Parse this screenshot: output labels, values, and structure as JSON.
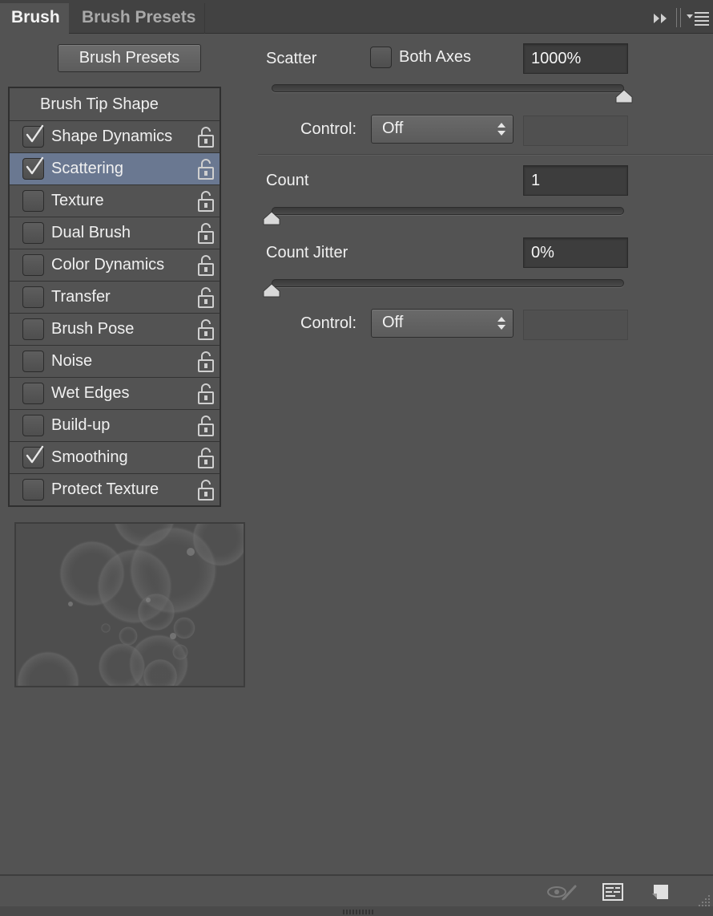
{
  "tabs": [
    {
      "label": "Brush",
      "active": true
    },
    {
      "label": "Brush Presets",
      "active": false
    }
  ],
  "left": {
    "presets_button": "Brush Presets",
    "list_header": "Brush Tip Shape",
    "options": [
      {
        "label": "Shape Dynamics",
        "checked": true,
        "selected": false
      },
      {
        "label": "Scattering",
        "checked": true,
        "selected": true
      },
      {
        "label": "Texture",
        "checked": false,
        "selected": false
      },
      {
        "label": "Dual Brush",
        "checked": false,
        "selected": false
      },
      {
        "label": "Color Dynamics",
        "checked": false,
        "selected": false
      },
      {
        "label": "Transfer",
        "checked": false,
        "selected": false
      },
      {
        "label": "Brush Pose",
        "checked": false,
        "selected": false
      },
      {
        "label": "Noise",
        "checked": false,
        "selected": false
      },
      {
        "label": "Wet Edges",
        "checked": false,
        "selected": false
      },
      {
        "label": "Build-up",
        "checked": false,
        "selected": false
      },
      {
        "label": "Smoothing",
        "checked": true,
        "selected": false
      },
      {
        "label": "Protect Texture",
        "checked": false,
        "selected": false
      }
    ]
  },
  "scatter": {
    "label": "Scatter",
    "both_axes_label": "Both Axes",
    "both_axes_checked": false,
    "value": "1000%",
    "slider_fraction": 1.0,
    "control_label": "Control:",
    "control_value": "Off"
  },
  "count": {
    "label": "Count",
    "value": "1",
    "slider_fraction": 0.0
  },
  "count_jitter": {
    "label": "Count Jitter",
    "value": "0%",
    "slider_fraction": 0.0,
    "control_label": "Control:",
    "control_value": "Off"
  },
  "footer_icons": [
    "toggle-live-tip-preview-icon",
    "open-preset-manager-icon",
    "create-new-brush-icon"
  ],
  "colors": {
    "panel_bg": "#535353",
    "tabbar_bg": "#424242",
    "selected_row": "#6a7891",
    "field_bg": "#3d3d3d"
  }
}
